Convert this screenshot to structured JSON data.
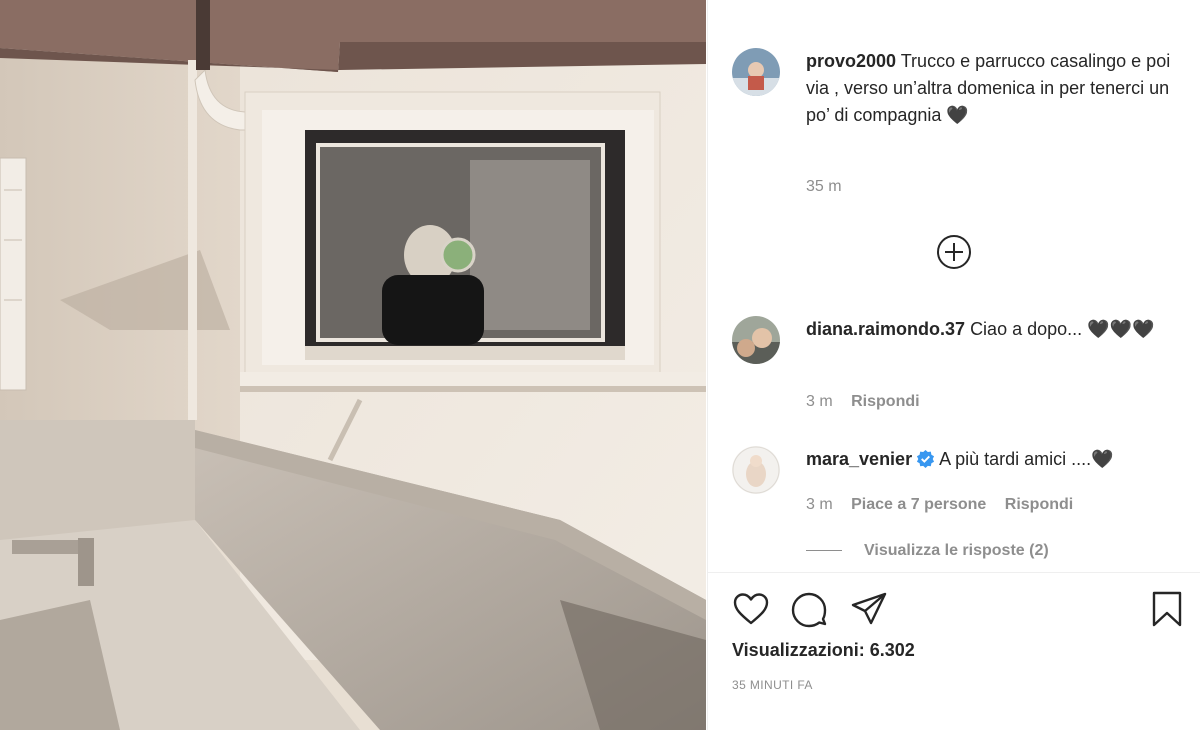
{
  "post": {
    "author": "provo2000",
    "caption": "Trucco e parrucco casalingo e poi via , verso un’altra domenica in per tenerci un po’ di compagnia 🖤",
    "age": "35 m"
  },
  "comments": [
    {
      "username": "diana.raimondo.37",
      "text": "Ciao a dopo... 🖤🖤🖤",
      "age": "3 m",
      "reply_label": "Rispondi"
    },
    {
      "username": "mara_venier",
      "verified": true,
      "text": "A più tardi amici ....🖤",
      "age": "3 m",
      "likes_label": "Piace a 7 persone",
      "reply_label": "Rispondi",
      "view_replies_label": "Visualizza le risposte (2)"
    }
  ],
  "actions": {
    "icons": [
      "heart-icon",
      "comment-icon",
      "share-icon",
      "bookmark-icon"
    ],
    "views_label": "Visualizzazioni:",
    "views_count": "6.302",
    "timestamp": "35 MINUTI FA"
  },
  "colors": {
    "text": "#262626",
    "muted": "#8e8e8e",
    "verified": "#3897f0",
    "divider": "#efefef"
  }
}
